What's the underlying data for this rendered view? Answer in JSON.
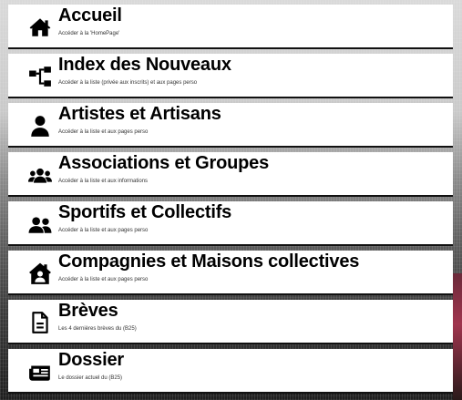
{
  "menu": {
    "items": [
      {
        "title": "Accueil",
        "desc": "Accéder à la 'HomePage'",
        "icon": "home-icon"
      },
      {
        "title": "Index des Nouveaux",
        "desc": "Accéder à la liste (privée aux inscrits) et aux pages perso",
        "icon": "sitemap-icon"
      },
      {
        "title": "Artistes et Artisans",
        "desc": "Accéder à la liste et aux pages perso",
        "icon": "user-icon"
      },
      {
        "title": "Associations et Groupes",
        "desc": "Accéder à la liste et aux informations",
        "icon": "users-group-icon"
      },
      {
        "title": "Sportifs et Collectifs",
        "desc": "Accéder à la liste et aux pages perso",
        "icon": "user-friends-icon"
      },
      {
        "title": "Compagnies et Maisons collectives",
        "desc": "Accéder à la liste et aux pages perso",
        "icon": "house-user-icon"
      },
      {
        "title": "Brèves",
        "desc": "Les 4 dernières brèves du (B25)",
        "icon": "file-text-icon"
      },
      {
        "title": "Dossier",
        "desc": "Le dossier actuel du (B25)",
        "icon": "newspaper-icon"
      }
    ]
  }
}
